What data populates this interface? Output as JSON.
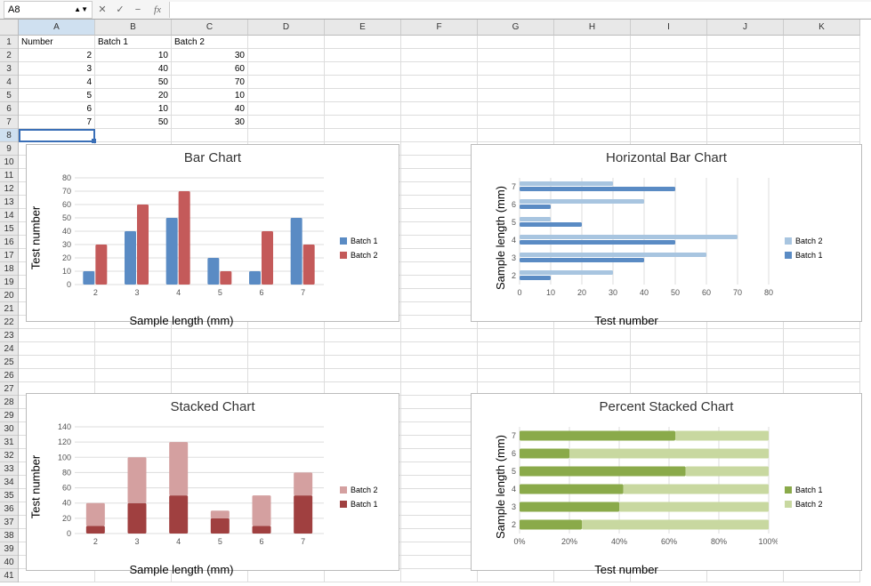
{
  "formula_bar": {
    "cell_ref": "A8",
    "fx": "fx"
  },
  "columns": [
    "A",
    "B",
    "C",
    "D",
    "E",
    "F",
    "G",
    "H",
    "I",
    "J",
    "K"
  ],
  "row_count": 41,
  "selected_col": 0,
  "selected_row": 8,
  "headers": [
    "Number",
    "Batch 1",
    "Batch 2"
  ],
  "data_rows": [
    [
      2,
      10,
      30
    ],
    [
      3,
      40,
      60
    ],
    [
      4,
      50,
      70
    ],
    [
      5,
      20,
      10
    ],
    [
      6,
      10,
      40
    ],
    [
      7,
      50,
      30
    ]
  ],
  "chart_data": [
    {
      "type": "bar",
      "title": "Bar Chart",
      "categories": [
        2,
        3,
        4,
        5,
        6,
        7
      ],
      "series": [
        {
          "name": "Batch 1",
          "values": [
            10,
            40,
            50,
            20,
            10,
            50
          ],
          "color": "#5a8bc4"
        },
        {
          "name": "Batch 2",
          "values": [
            30,
            60,
            70,
            10,
            40,
            30
          ],
          "color": "#c45a5a"
        }
      ],
      "xlabel": "Sample length (mm)",
      "ylabel": "Test number",
      "ylim": [
        0,
        80
      ],
      "ystep": 10
    },
    {
      "type": "hbar",
      "title": "Horizontal Bar Chart",
      "categories": [
        2,
        3,
        4,
        5,
        6,
        7
      ],
      "series": [
        {
          "name": "Batch 2",
          "values": [
            30,
            60,
            70,
            10,
            40,
            30
          ],
          "color": "#a8c5e0"
        },
        {
          "name": "Batch 1",
          "values": [
            10,
            40,
            50,
            20,
            10,
            50
          ],
          "color": "#5a8bc4"
        }
      ],
      "xlabel": "Test number",
      "ylabel": "Sample length (mm)",
      "xlim": [
        0,
        80
      ],
      "xstep": 10
    },
    {
      "type": "stacked",
      "title": "Stacked Chart",
      "categories": [
        2,
        3,
        4,
        5,
        6,
        7
      ],
      "series": [
        {
          "name": "Batch 2",
          "values": [
            30,
            60,
            70,
            10,
            40,
            30
          ],
          "color": "#d4a0a0"
        },
        {
          "name": "Batch 1",
          "values": [
            10,
            40,
            50,
            20,
            10,
            50
          ],
          "color": "#a04040"
        }
      ],
      "xlabel": "Sample length (mm)",
      "ylabel": "Test number",
      "ylim": [
        0,
        140
      ],
      "ystep": 20
    },
    {
      "type": "pct_stacked_h",
      "title": "Percent Stacked Chart",
      "categories": [
        2,
        3,
        4,
        5,
        6,
        7
      ],
      "series": [
        {
          "name": "Batch 1",
          "values": [
            10,
            40,
            50,
            20,
            10,
            50
          ],
          "color": "#8aaa4a"
        },
        {
          "name": "Batch 2",
          "values": [
            30,
            60,
            70,
            10,
            40,
            30
          ],
          "color": "#c8d8a0"
        }
      ],
      "xlabel": "Test number",
      "ylabel": "Sample length (mm)",
      "xlim": [
        0,
        100
      ],
      "xstep": 20,
      "xfmt": "%"
    }
  ]
}
